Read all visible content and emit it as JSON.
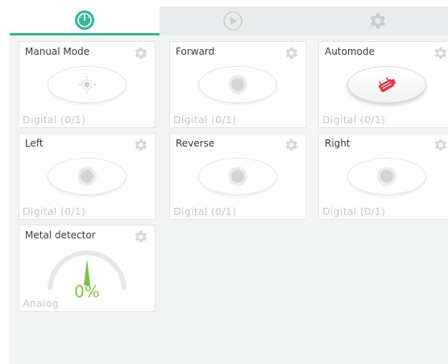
{
  "tabs": [
    {
      "icon": "gauge-icon",
      "active": true
    },
    {
      "icon": "play-icon",
      "active": false
    },
    {
      "icon": "gear-icon",
      "active": false
    }
  ],
  "colors": {
    "accent": "#35b79a",
    "gauge_green": "#7cc142",
    "automode_icon": "#e03b4a"
  },
  "widgets": [
    {
      "title": "Manual Mode",
      "footer": "Digital (0/1)",
      "state": "off"
    },
    {
      "title": "Forward",
      "footer": "Digital (0/1)",
      "state": "off"
    },
    {
      "title": "Automode",
      "footer": "Digital (0/1)",
      "state": "on"
    },
    {
      "title": "Left",
      "footer": "Digital (0/1)",
      "state": "off"
    },
    {
      "title": "Reverse",
      "footer": "Digital (0/1)",
      "state": "off"
    },
    {
      "title": "Right",
      "footer": "Digital (0/1)",
      "state": "off"
    },
    {
      "title": "Metal detector",
      "footer": "Analog",
      "value": "0%",
      "level": 0
    }
  ]
}
